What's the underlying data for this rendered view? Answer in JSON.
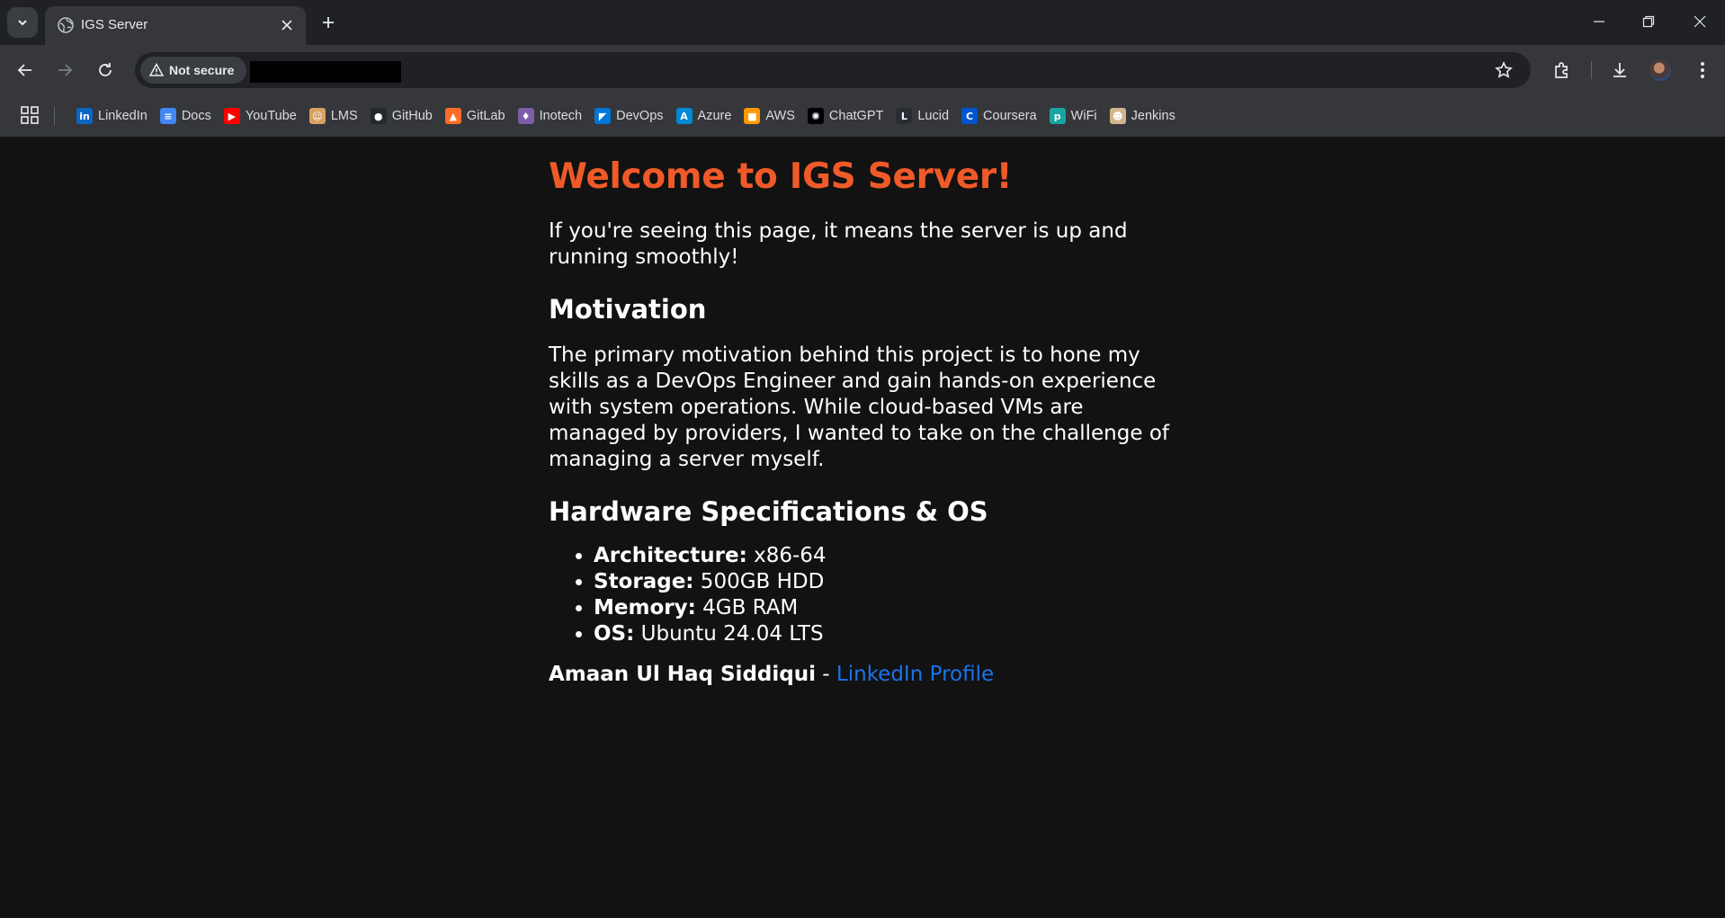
{
  "browser": {
    "tab": {
      "title": "IGS Server"
    },
    "security_chip": "Not secure",
    "bookmarks": [
      {
        "label": "LinkedIn",
        "icon": "linkedin-icon",
        "color": "#0a66c2",
        "glyph": "in"
      },
      {
        "label": "Docs",
        "icon": "docs-icon",
        "color": "#4285f4",
        "glyph": "≡"
      },
      {
        "label": "YouTube",
        "icon": "youtube-icon",
        "color": "#ff0000",
        "glyph": "▶"
      },
      {
        "label": "LMS",
        "icon": "lms-icon",
        "color": "#d9a066",
        "glyph": "☺"
      },
      {
        "label": "GitHub",
        "icon": "github-icon",
        "color": "#24292e",
        "glyph": "●"
      },
      {
        "label": "GitLab",
        "icon": "gitlab-icon",
        "color": "#fc6d26",
        "glyph": "▲"
      },
      {
        "label": "Inotech",
        "icon": "inotech-icon",
        "color": "#7b5ea7",
        "glyph": "♦"
      },
      {
        "label": "DevOps",
        "icon": "devops-icon",
        "color": "#0078d7",
        "glyph": "◤"
      },
      {
        "label": "Azure",
        "icon": "azure-icon",
        "color": "#0089d6",
        "glyph": "A"
      },
      {
        "label": "AWS",
        "icon": "aws-icon",
        "color": "#ff9900",
        "glyph": "■"
      },
      {
        "label": "ChatGPT",
        "icon": "chatgpt-icon",
        "color": "#000000",
        "glyph": "✺"
      },
      {
        "label": "Lucid",
        "icon": "lucid-icon",
        "color": "#282c33",
        "glyph": "L"
      },
      {
        "label": "Coursera",
        "icon": "coursera-icon",
        "color": "#0056d2",
        "glyph": "C"
      },
      {
        "label": "WiFi",
        "icon": "wifi-icon",
        "color": "#1aa3a3",
        "glyph": "p"
      },
      {
        "label": "Jenkins",
        "icon": "jenkins-icon",
        "color": "#d4b48c",
        "glyph": "☻"
      }
    ]
  },
  "page": {
    "heading": "Welcome to IGS Server!",
    "intro": "If you're seeing this page, it means the server is up and running smoothly!",
    "motivation_heading": "Motivation",
    "motivation_text": "The primary motivation behind this project is to hone my skills as a DevOps Engineer and gain hands-on experience with system operations. While cloud-based VMs are managed by providers, I wanted to take on the challenge of managing a server myself.",
    "hardware_heading": "Hardware Specifications & OS",
    "specs": [
      {
        "label": "Architecture:",
        "value": " x86-64"
      },
      {
        "label": "Storage:",
        "value": " 500GB HDD"
      },
      {
        "label": "Memory:",
        "value": " 4GB RAM"
      },
      {
        "label": "OS:",
        "value": " Ubuntu 24.04 LTS"
      }
    ],
    "author": "Amaan Ul Haq Siddiqui",
    "separator": " - ",
    "link_text": "LinkedIn Profile"
  },
  "colors": {
    "heading": "#f05a28",
    "link": "#1a73e8",
    "background": "#121212"
  }
}
